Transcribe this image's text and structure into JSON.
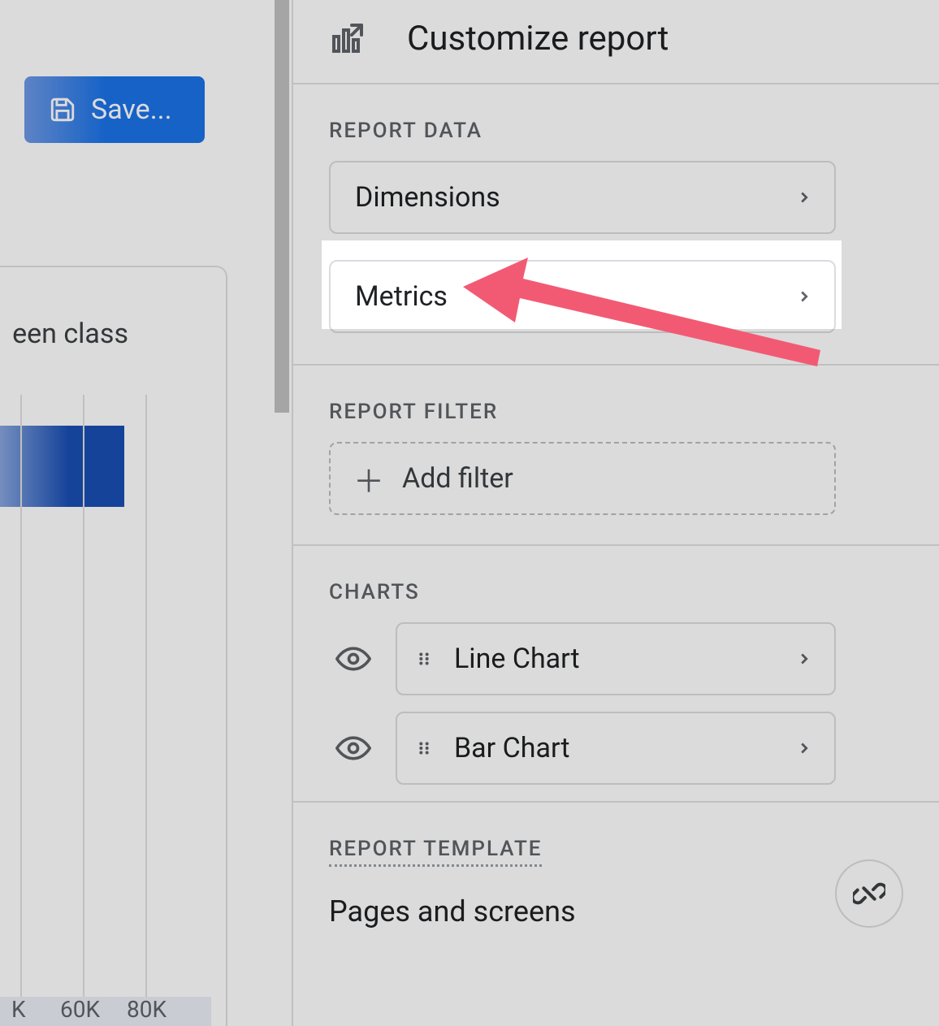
{
  "left": {
    "save_label": "Save...",
    "card_title_fragment": "een class",
    "xticks": [
      "K",
      "60K",
      "80K"
    ]
  },
  "panel": {
    "title": "Customize report",
    "report_data_label": "REPORT DATA",
    "dimensions_label": "Dimensions",
    "metrics_label": "Metrics",
    "report_filter_label": "REPORT FILTER",
    "add_filter_label": "Add filter",
    "charts_label": "CHARTS",
    "charts": [
      {
        "label": "Line Chart"
      },
      {
        "label": "Bar Chart"
      }
    ],
    "report_template_label": "REPORT TEMPLATE",
    "template_name": "Pages and screens"
  }
}
